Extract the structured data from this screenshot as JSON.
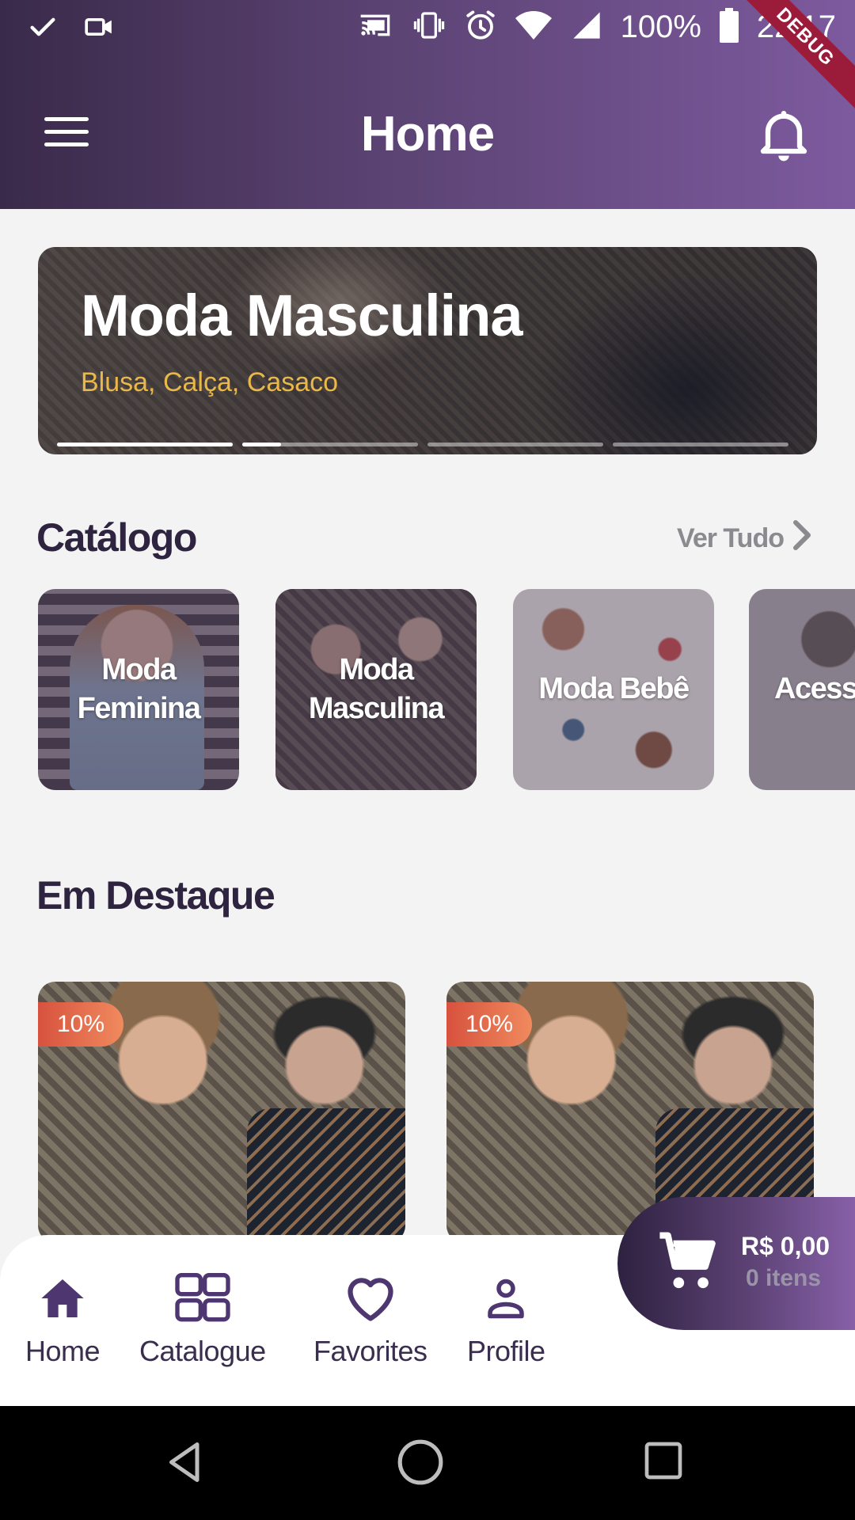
{
  "status_bar": {
    "battery": "100%",
    "time": "22:17",
    "debug_label": "DEBUG",
    "icons": [
      "check-icon",
      "video-camera-icon",
      "cast-icon",
      "vibrate-icon",
      "alarm-icon",
      "wifi-icon",
      "cellular-signal-icon",
      "battery-icon"
    ]
  },
  "app_bar": {
    "title": "Home",
    "icons": [
      "menu-icon",
      "bell-icon"
    ]
  },
  "banner": {
    "title": "Moda Masculina",
    "subtitle": "Blusa, Calça, Casaco",
    "subtitle_color": "#e8b84a",
    "slides": 4,
    "active_slide": 2,
    "active_progress": 0.22
  },
  "catalog": {
    "title": "Catálogo",
    "see_all": "Ver Tudo",
    "items": [
      {
        "label": "Moda Feminina"
      },
      {
        "label": "Moda Masculina"
      },
      {
        "label": "Moda Bebê"
      },
      {
        "label": "Acess"
      }
    ]
  },
  "featured": {
    "title": "Em Destaque",
    "products": [
      {
        "discount": "10%"
      },
      {
        "discount": "10%"
      }
    ]
  },
  "cart": {
    "price": "R$ 0,00",
    "items": "0 itens"
  },
  "bottom_nav": {
    "items": [
      {
        "label": "Home",
        "icon": "home-icon",
        "active": true
      },
      {
        "label": "Catalogue",
        "icon": "grid-icon",
        "active": false
      },
      {
        "label": "Favorites",
        "icon": "heart-icon",
        "active": false
      },
      {
        "label": "Profile",
        "icon": "person-icon",
        "active": false
      }
    ]
  },
  "colors": {
    "primary_dark": "#3a2a4a",
    "primary_light": "#7d5a9e",
    "text_dark": "#2f2440",
    "badge": "#e4674a",
    "background": "#f2f3f2"
  }
}
